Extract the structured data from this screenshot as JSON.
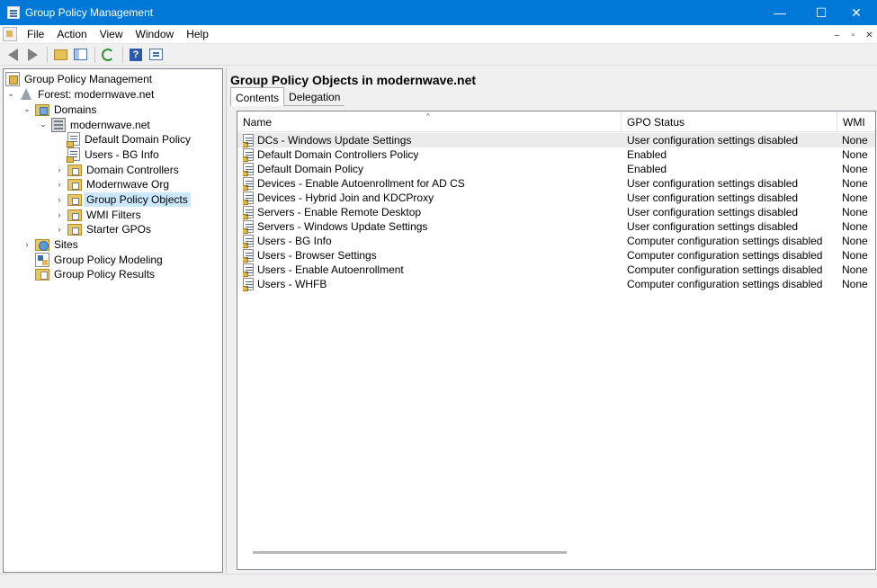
{
  "window": {
    "title": "Group Policy Management",
    "controls": {
      "minimize": "—",
      "maximize": "☐",
      "close": "✕"
    }
  },
  "menu": {
    "items": [
      "File",
      "Action",
      "View",
      "Window",
      "Help"
    ],
    "mdi_controls": [
      "–",
      "▫",
      "✕"
    ]
  },
  "toolbar": {
    "icons": [
      "back-arrow-icon",
      "forward-arrow-icon",
      "up-folder-icon",
      "show-hide-tree-icon",
      "refresh-icon",
      "help-icon",
      "properties-icon"
    ]
  },
  "tree": {
    "items": [
      {
        "label": "Group Policy Management",
        "icon": "gpm-icon",
        "expander": ""
      },
      {
        "label": "Forest: modernwave.net",
        "icon": "forest-icon",
        "expander": "⌄"
      },
      {
        "label": "Domains",
        "icon": "domains-folder-icon",
        "expander": "⌄"
      },
      {
        "label": "modernwave.net",
        "icon": "domain-icon",
        "expander": "⌄"
      },
      {
        "label": "Default Domain Policy",
        "icon": "gpo-link-icon",
        "expander": ""
      },
      {
        "label": "Users - BG Info",
        "icon": "gpo-link-icon",
        "expander": ""
      },
      {
        "label": "Domain Controllers",
        "icon": "ou-folder-icon",
        "expander": "›"
      },
      {
        "label": "Modernwave Org",
        "icon": "ou-folder-icon",
        "expander": "›"
      },
      {
        "label": "Group Policy Objects",
        "icon": "gpo-folder-icon",
        "expander": "›",
        "selected": true
      },
      {
        "label": "WMI Filters",
        "icon": "wmi-folder-icon",
        "expander": "›"
      },
      {
        "label": "Starter GPOs",
        "icon": "starter-folder-icon",
        "expander": "›"
      },
      {
        "label": "Sites",
        "icon": "sites-icon",
        "expander": "›"
      },
      {
        "label": "Group Policy Modeling",
        "icon": "modeling-icon",
        "expander": ""
      },
      {
        "label": "Group Policy Results",
        "icon": "results-icon",
        "expander": ""
      }
    ]
  },
  "main": {
    "heading": "Group Policy Objects in modernwave.net",
    "tabs": [
      {
        "label": "Contents",
        "active": true
      },
      {
        "label": "Delegation",
        "active": false
      }
    ],
    "columns": {
      "name": "Name",
      "status": "GPO Status",
      "wmi": "WMI"
    },
    "sort_indicator": "^",
    "rows": [
      {
        "name": "DCs - Windows Update Settings",
        "status": "User configuration settings disabled",
        "wmi": "None"
      },
      {
        "name": "Default Domain Controllers Policy",
        "status": "Enabled",
        "wmi": "None"
      },
      {
        "name": "Default Domain Policy",
        "status": "Enabled",
        "wmi": "None"
      },
      {
        "name": "Devices - Enable Autoenrollment for AD CS",
        "status": "User configuration settings disabled",
        "wmi": "None"
      },
      {
        "name": "Devices - Hybrid Join and KDCProxy",
        "status": "User configuration settings disabled",
        "wmi": "None"
      },
      {
        "name": "Servers - Enable Remote Desktop",
        "status": "User configuration settings disabled",
        "wmi": "None"
      },
      {
        "name": "Servers - Windows Update Settings",
        "status": "User configuration settings disabled",
        "wmi": "None"
      },
      {
        "name": "Users - BG Info",
        "status": "Computer configuration settings disabled",
        "wmi": "None"
      },
      {
        "name": "Users - Browser Settings",
        "status": "Computer configuration settings disabled",
        "wmi": "None"
      },
      {
        "name": "Users - Enable Autoenrollment",
        "status": "Computer configuration settings disabled",
        "wmi": "None"
      },
      {
        "name": "Users - WHFB",
        "status": "Computer configuration settings disabled",
        "wmi": "None"
      }
    ]
  },
  "colors": {
    "titlebar": "#0078d7",
    "selection": "#cce8ff",
    "row_hover": "#ebebeb"
  }
}
